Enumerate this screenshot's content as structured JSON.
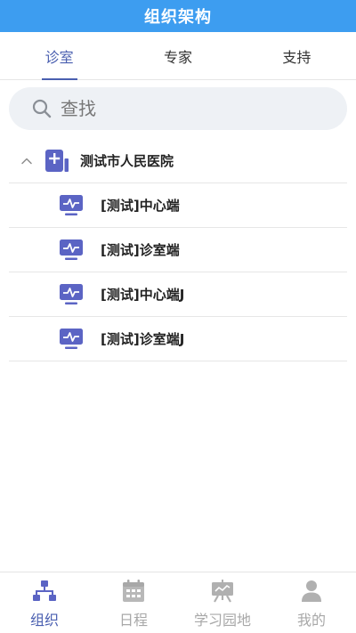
{
  "header": {
    "title": "组织架构"
  },
  "tabs": [
    {
      "label": "诊室",
      "active": true
    },
    {
      "label": "专家",
      "active": false
    },
    {
      "label": "支持",
      "active": false
    }
  ],
  "search": {
    "placeholder": "查找",
    "icon": "search-icon"
  },
  "tree": {
    "hospital": {
      "label": "测试市人民医院",
      "expanded": true,
      "icon": "hospital-plus-icon"
    },
    "children": [
      {
        "label": "[测试]中心端",
        "icon": "monitor-pulse-icon"
      },
      {
        "label": "[测试]诊室端",
        "icon": "monitor-pulse-icon"
      },
      {
        "label": "[测试]中心端J",
        "icon": "monitor-pulse-icon"
      },
      {
        "label": "[测试]诊室端J",
        "icon": "monitor-pulse-icon"
      }
    ]
  },
  "bottom_nav": [
    {
      "label": "组织",
      "active": true,
      "icon": "org-chart-icon"
    },
    {
      "label": "日程",
      "active": false,
      "icon": "calendar-icon"
    },
    {
      "label": "学习园地",
      "active": false,
      "icon": "easel-board-icon"
    },
    {
      "label": "我的",
      "active": false,
      "icon": "person-icon"
    }
  ],
  "colors": {
    "header": "#3d9df0",
    "accent": "#4a5fb0",
    "icon": "#5b64c4",
    "inactive": "#a8a8a8",
    "search_bg": "#eef1f5"
  }
}
